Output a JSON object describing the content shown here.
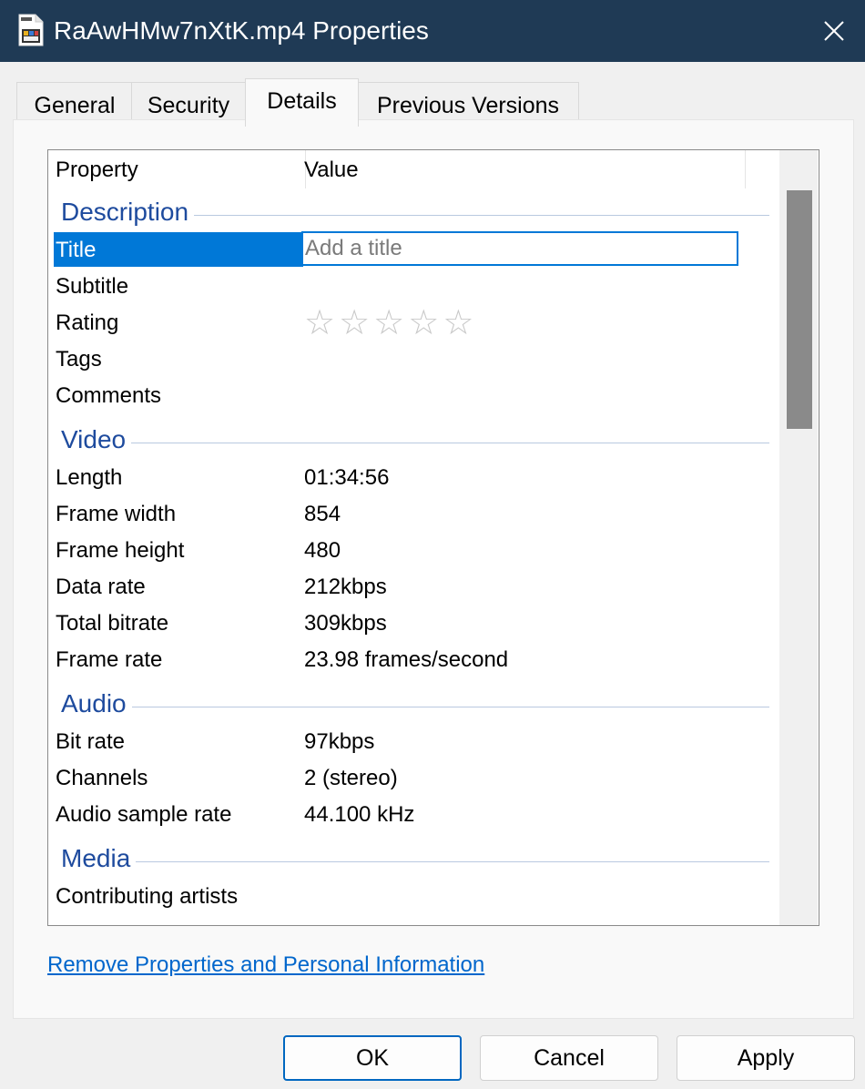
{
  "window": {
    "title": "RaAwHMw7nXtK.mp4 Properties",
    "icon": "mp4-file-icon",
    "close_icon": "close-icon"
  },
  "tabs": [
    {
      "label": "General",
      "active": false
    },
    {
      "label": "Security",
      "active": false
    },
    {
      "label": "Details",
      "active": true
    },
    {
      "label": "Previous Versions",
      "active": false
    }
  ],
  "columns": {
    "property": "Property",
    "value": "Value"
  },
  "groups": {
    "description": {
      "label": "Description",
      "rows": [
        {
          "name": "Title",
          "value": "",
          "placeholder": "Add a title"
        },
        {
          "name": "Subtitle",
          "value": ""
        },
        {
          "name": "Rating",
          "stars": 0,
          "max_stars": 5
        },
        {
          "name": "Tags",
          "value": ""
        },
        {
          "name": "Comments",
          "value": ""
        }
      ]
    },
    "video": {
      "label": "Video",
      "rows": [
        {
          "name": "Length",
          "value": "01:34:56"
        },
        {
          "name": "Frame width",
          "value": "854"
        },
        {
          "name": "Frame height",
          "value": "480"
        },
        {
          "name": "Data rate",
          "value": "212kbps"
        },
        {
          "name": "Total bitrate",
          "value": "309kbps"
        },
        {
          "name": "Frame rate",
          "value": "23.98 frames/second"
        }
      ]
    },
    "audio": {
      "label": "Audio",
      "rows": [
        {
          "name": "Bit rate",
          "value": "97kbps"
        },
        {
          "name": "Channels",
          "value": "2 (stereo)"
        },
        {
          "name": "Audio sample rate",
          "value": "44.100 kHz"
        }
      ]
    },
    "media": {
      "label": "Media",
      "rows": [
        {
          "name": "Contributing artists",
          "value": ""
        }
      ]
    }
  },
  "rating_glyph": "☆",
  "remove_link": "Remove Properties and Personal Information",
  "buttons": {
    "ok": "OK",
    "cancel": "Cancel",
    "apply": "Apply"
  },
  "colors": {
    "titlebar": "#1f3a55",
    "selection": "#0078d7",
    "group_header": "#1e4b9e",
    "link": "#0066cc"
  }
}
